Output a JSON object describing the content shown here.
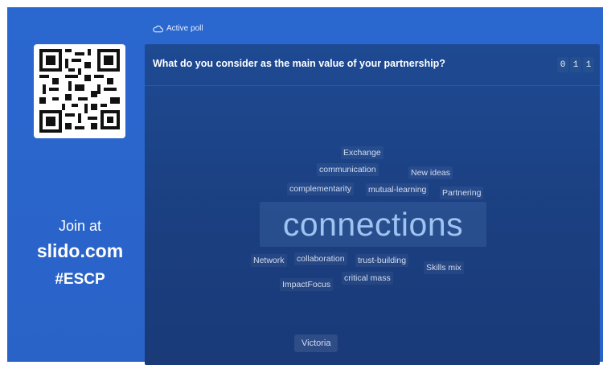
{
  "header": {
    "status_label": "Active poll",
    "status_icon": "cloud-icon"
  },
  "join": {
    "prefix": "Join at",
    "url": "slido.com",
    "code": "#ESCP"
  },
  "poll": {
    "question": "What do you consider as the main value of your partnership?",
    "counter_digits": [
      "0",
      "1",
      "1"
    ],
    "top_word": "connections",
    "words": [
      "Exchange",
      "communication",
      "New ideas",
      "complementarity",
      "mutual-learning",
      "Partnering",
      "Network",
      "collaboration",
      "trust-building",
      "Skills mix",
      "ImpactFocus",
      "critical mass"
    ],
    "author": "Victoria"
  },
  "colors": {
    "stage": "#2a67cf",
    "panel": "#1e4a93",
    "highlight": "#9fc4f2"
  }
}
